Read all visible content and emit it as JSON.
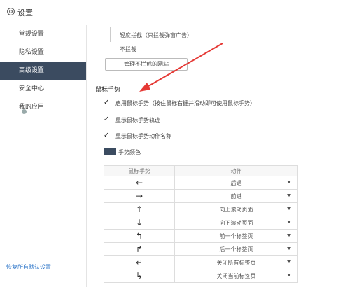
{
  "header": {
    "title": "设置"
  },
  "sidebar": {
    "items": [
      {
        "label": "常规设置"
      },
      {
        "label": "隐私设置"
      },
      {
        "label": "高级设置"
      },
      {
        "label": "安全中心"
      },
      {
        "label": "我的应用"
      }
    ],
    "active_index": 2,
    "restore_defaults": "恢复所有默认设置"
  },
  "main": {
    "options": [
      {
        "label": "轻度拦截（只拦截弹窗广告）"
      },
      {
        "label": "不拦截"
      }
    ],
    "manage_button": "管理不拦截的网站",
    "section_title": "鼠标手势",
    "checkboxes": [
      {
        "label": "启用鼠标手势（按住鼠标右键并滑动即可使用鼠标手势）",
        "checked": true
      },
      {
        "label": "显示鼠标手势轨迹",
        "checked": true
      },
      {
        "label": "显示鼠标手势动作名称",
        "checked": true
      }
    ],
    "color_label": "手势颜色",
    "gesture_color": "#3b4b60",
    "table": {
      "headers": [
        "鼠标手势",
        "动作"
      ],
      "rows": [
        {
          "gesture": "←",
          "action": "后退"
        },
        {
          "gesture": "→",
          "action": "前进"
        },
        {
          "gesture": "↑",
          "action": "向上滚动页面"
        },
        {
          "gesture": "↓",
          "action": "向下滚动页面"
        },
        {
          "gesture": "↰",
          "action": "前一个标签页"
        },
        {
          "gesture": "↱",
          "action": "后一个标签页"
        },
        {
          "gesture": "↵",
          "action": "关闭所有标签页"
        },
        {
          "gesture": "↳",
          "action": "关闭当前标签页"
        }
      ]
    }
  },
  "colors": {
    "sidebar_active": "#3b4b60",
    "link": "#2b74c8",
    "annotation_arrow": "#e53935"
  }
}
